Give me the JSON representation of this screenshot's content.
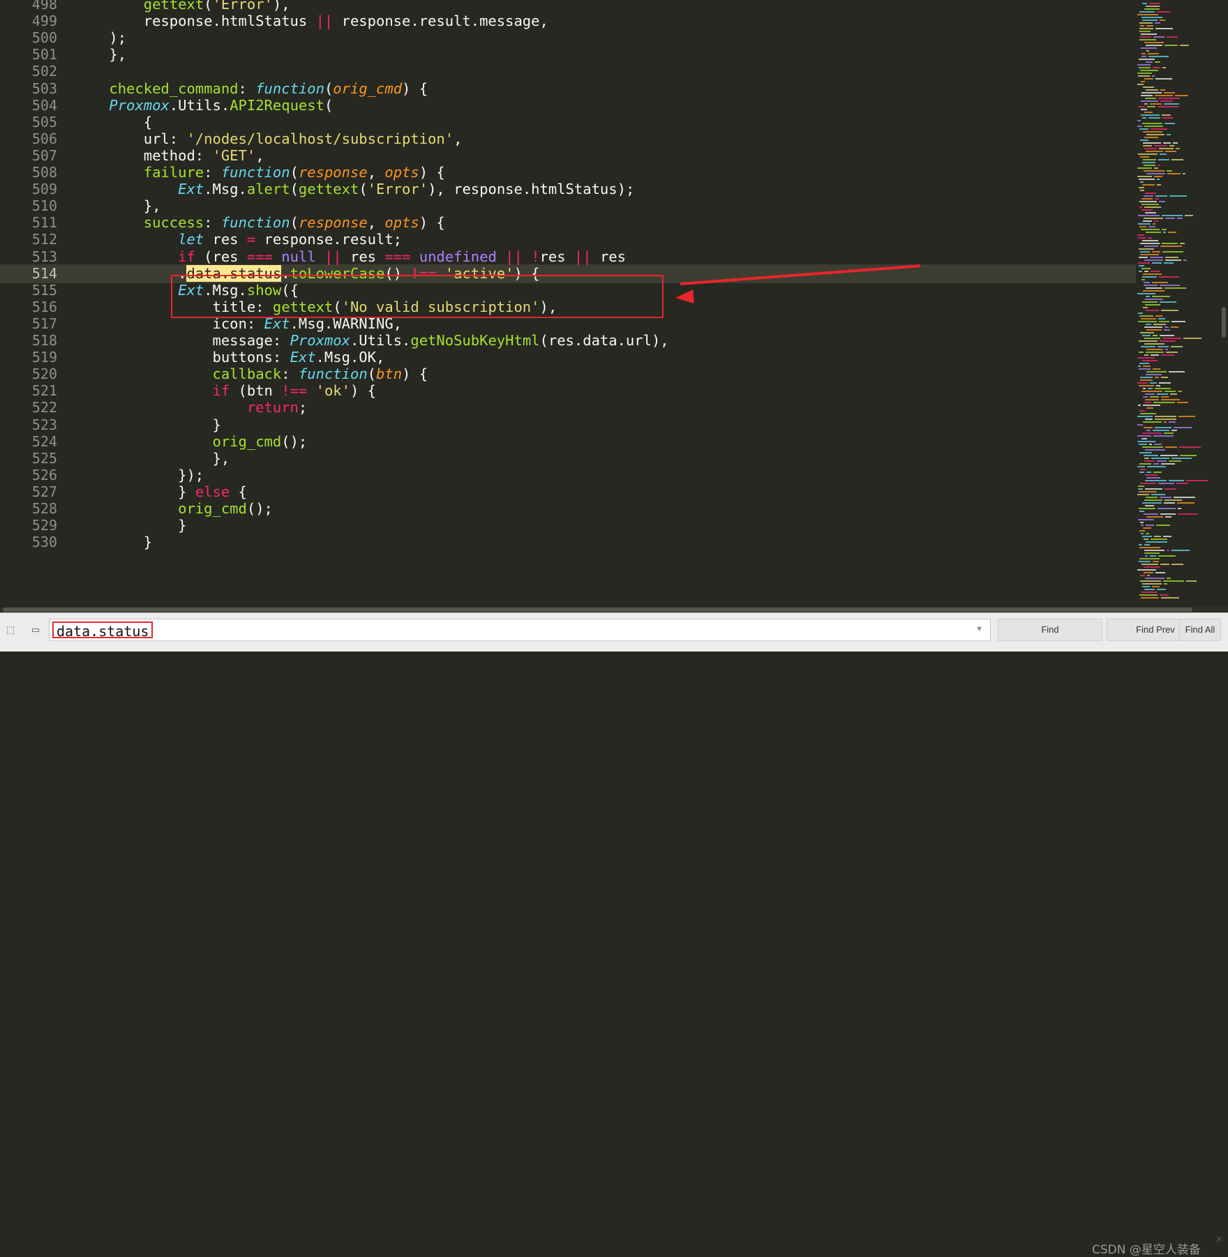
{
  "lines": [
    {
      "n": "498",
      "segs": [
        [
          "        ",
          ""
        ],
        [
          "gettext",
          "fn"
        ],
        [
          "(",
          "p"
        ],
        [
          "'Error'",
          "s"
        ],
        [
          "),",
          "p"
        ]
      ]
    },
    {
      "n": "499",
      "segs": [
        [
          "        response.htmlStatus ",
          ""
        ],
        [
          "||",
          "op"
        ],
        [
          " response.result.message,",
          ""
        ]
      ]
    },
    {
      "n": "500",
      "segs": [
        [
          "    );",
          ""
        ]
      ]
    },
    {
      "n": "501",
      "segs": [
        [
          "    },",
          ""
        ]
      ]
    },
    {
      "n": "502",
      "segs": [
        [
          "",
          ""
        ]
      ]
    },
    {
      "n": "503",
      "segs": [
        [
          "    ",
          ""
        ],
        [
          "checked_command",
          "fn"
        ],
        [
          ": ",
          ""
        ],
        [
          "function",
          "kw"
        ],
        [
          "(",
          "p"
        ],
        [
          "orig_cmd",
          "par"
        ],
        [
          ") {",
          ""
        ]
      ]
    },
    {
      "n": "504",
      "segs": [
        [
          "    ",
          ""
        ],
        [
          "Proxmox",
          "cls"
        ],
        [
          ".Utils.",
          ""
        ],
        [
          "API2Request",
          "fn"
        ],
        [
          "(",
          ""
        ]
      ]
    },
    {
      "n": "505",
      "segs": [
        [
          "        {",
          ""
        ]
      ]
    },
    {
      "n": "506",
      "segs": [
        [
          "        url: ",
          ""
        ],
        [
          "'/nodes/localhost/subscription'",
          "s"
        ],
        [
          ",",
          ""
        ]
      ]
    },
    {
      "n": "507",
      "segs": [
        [
          "        method: ",
          ""
        ],
        [
          "'GET'",
          "s"
        ],
        [
          ",",
          ""
        ]
      ]
    },
    {
      "n": "508",
      "segs": [
        [
          "        ",
          ""
        ],
        [
          "failure",
          "fn"
        ],
        [
          ": ",
          ""
        ],
        [
          "function",
          "kw"
        ],
        [
          "(",
          ""
        ],
        [
          "response",
          "par"
        ],
        [
          ", ",
          ""
        ],
        [
          "opts",
          "par"
        ],
        [
          ") {",
          ""
        ]
      ]
    },
    {
      "n": "509",
      "segs": [
        [
          "            ",
          ""
        ],
        [
          "Ext",
          "cls"
        ],
        [
          ".Msg.",
          ""
        ],
        [
          "alert",
          "fn"
        ],
        [
          "(",
          ""
        ],
        [
          "gettext",
          "fn"
        ],
        [
          "(",
          ""
        ],
        [
          "'Error'",
          "s"
        ],
        [
          "), response.htmlStatus);",
          ""
        ]
      ]
    },
    {
      "n": "510",
      "segs": [
        [
          "        },",
          ""
        ]
      ]
    },
    {
      "n": "511",
      "segs": [
        [
          "        ",
          ""
        ],
        [
          "success",
          "fn"
        ],
        [
          ": ",
          ""
        ],
        [
          "function",
          "kw"
        ],
        [
          "(",
          ""
        ],
        [
          "response",
          "par"
        ],
        [
          ", ",
          ""
        ],
        [
          "opts",
          "par"
        ],
        [
          ") {",
          ""
        ]
      ]
    },
    {
      "n": "512",
      "segs": [
        [
          "            ",
          ""
        ],
        [
          "let",
          "kw"
        ],
        [
          " res ",
          ""
        ],
        [
          "=",
          "op"
        ],
        [
          " response.result;",
          ""
        ]
      ]
    },
    {
      "n": "513",
      "segs": [
        [
          "            ",
          ""
        ],
        [
          "if",
          "op"
        ],
        [
          " (res ",
          ""
        ],
        [
          "===",
          "op"
        ],
        [
          " ",
          ""
        ],
        [
          "null",
          "num"
        ],
        [
          " ",
          ""
        ],
        [
          "||",
          "op"
        ],
        [
          " res ",
          ""
        ],
        [
          "===",
          "op"
        ],
        [
          " ",
          ""
        ],
        [
          "undefined",
          "num"
        ],
        [
          " ",
          ""
        ],
        [
          "||",
          "op"
        ],
        [
          " ",
          ""
        ],
        [
          "!",
          "op"
        ],
        [
          "res ",
          ""
        ],
        [
          "||",
          "op"
        ],
        [
          " res",
          ""
        ]
      ]
    },
    {
      "n": "514",
      "segs": [
        [
          "            .",
          ""
        ],
        [
          "data.status",
          "match"
        ],
        [
          ".",
          ""
        ],
        [
          "toLowerCase",
          "fn"
        ],
        [
          "() ",
          ""
        ],
        [
          "!==",
          "op"
        ],
        [
          " ",
          ""
        ],
        [
          "'active'",
          "s"
        ],
        [
          ") {",
          ""
        ]
      ]
    },
    {
      "n": "515",
      "segs": [
        [
          "            ",
          ""
        ],
        [
          "Ext",
          "cls"
        ],
        [
          ".Msg.",
          ""
        ],
        [
          "show",
          "fn"
        ],
        [
          "({",
          ""
        ]
      ]
    },
    {
      "n": "516",
      "segs": [
        [
          "                title: ",
          ""
        ],
        [
          "gettext",
          "fn"
        ],
        [
          "(",
          ""
        ],
        [
          "'No valid subscription'",
          "s"
        ],
        [
          "),",
          ""
        ]
      ]
    },
    {
      "n": "517",
      "segs": [
        [
          "                icon: ",
          ""
        ],
        [
          "Ext",
          "cls"
        ],
        [
          ".Msg.WARNING,",
          ""
        ]
      ]
    },
    {
      "n": "518",
      "segs": [
        [
          "                message: ",
          ""
        ],
        [
          "Proxmox",
          "cls"
        ],
        [
          ".Utils.",
          ""
        ],
        [
          "getNoSubKeyHtml",
          "fn"
        ],
        [
          "(res.data.url),",
          ""
        ]
      ]
    },
    {
      "n": "519",
      "segs": [
        [
          "                buttons: ",
          ""
        ],
        [
          "Ext",
          "cls"
        ],
        [
          ".Msg.OK,",
          ""
        ]
      ]
    },
    {
      "n": "520",
      "segs": [
        [
          "                ",
          ""
        ],
        [
          "callback",
          "fn"
        ],
        [
          ": ",
          ""
        ],
        [
          "function",
          "kw"
        ],
        [
          "(",
          ""
        ],
        [
          "btn",
          "par"
        ],
        [
          ") {",
          ""
        ]
      ]
    },
    {
      "n": "521",
      "segs": [
        [
          "                ",
          ""
        ],
        [
          "if",
          "op"
        ],
        [
          " (btn ",
          ""
        ],
        [
          "!==",
          "op"
        ],
        [
          " ",
          ""
        ],
        [
          "'ok'",
          "s"
        ],
        [
          ") {",
          ""
        ]
      ]
    },
    {
      "n": "522",
      "segs": [
        [
          "                    ",
          ""
        ],
        [
          "return",
          "op"
        ],
        [
          ";",
          ""
        ]
      ]
    },
    {
      "n": "523",
      "segs": [
        [
          "                }",
          ""
        ]
      ]
    },
    {
      "n": "524",
      "segs": [
        [
          "                ",
          ""
        ],
        [
          "orig_cmd",
          "fn"
        ],
        [
          "();",
          ""
        ]
      ]
    },
    {
      "n": "525",
      "segs": [
        [
          "                },",
          ""
        ]
      ]
    },
    {
      "n": "526",
      "segs": [
        [
          "            });",
          ""
        ]
      ]
    },
    {
      "n": "527",
      "segs": [
        [
          "            } ",
          ""
        ],
        [
          "else",
          "op"
        ],
        [
          " {",
          ""
        ]
      ]
    },
    {
      "n": "528",
      "segs": [
        [
          "            ",
          ""
        ],
        [
          "orig_cmd",
          "fn"
        ],
        [
          "();",
          ""
        ]
      ]
    },
    {
      "n": "529",
      "segs": [
        [
          "            }",
          ""
        ]
      ]
    },
    {
      "n": "530",
      "segs": [
        [
          "        }",
          ""
        ]
      ]
    }
  ],
  "current_line": "514",
  "colors": {
    "background": "#272822",
    "keyword": "#66d9ef",
    "function": "#a6e22e",
    "string": "#e6db74",
    "operator": "#f92672",
    "constant": "#ae81ff",
    "parameter": "#fd971f",
    "annotation": "#e8262a"
  },
  "findbar": {
    "query": "data.status",
    "find_label": "Find",
    "find_prev_label": "Find Prev",
    "find_all_label": "Find All",
    "regex_icon": "regex-toggle-icon",
    "case_icon": "case-toggle-icon",
    "close_icon": "close-icon"
  },
  "watermark": "CSDN @星空人装备"
}
